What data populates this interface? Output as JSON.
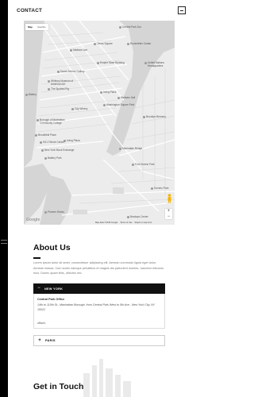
{
  "header": {
    "title": "CONTACT"
  },
  "map": {
    "type_buttons": [
      "Map",
      "Satellite"
    ],
    "labels": [
      "Central Park Zoo",
      "Times Square",
      "Rockefeller Center",
      "Madison Ave",
      "Empire State Building",
      "United Nations Headquarters",
      "David Zwirner Gallery",
      "Whitney Museum of American Art",
      "Irving Place",
      "Webster Hall",
      "Washington Square Park",
      "The Spotted Pig",
      "City Winery",
      "Borough of Manhattan Community College",
      "Brooklyn Brewery",
      "Brookfield Place",
      "9/11 Tribute Center",
      "New York Stock Exchange",
      "Battery Park",
      "Manhattan Bridge",
      "Fort Greene Park",
      "Pioneer Works",
      "Barclays Center",
      "Irving Plaza",
      "Domino Park",
      "Bakery"
    ],
    "zoom_in": "+",
    "zoom_out": "−",
    "logo": "Google",
    "attribution": [
      "Map data ©2019 Google",
      "Terms of Use",
      "Report a map error"
    ]
  },
  "about": {
    "title": "About Us",
    "text": "Lorem ipsum dolor sit amet, consectetuer adipiscing elit. Aenean commodo ligula eget dolor. Aenean massa. Cum sociis natoque penatibus et magnis dis parturient montes, nascetur ridiculus mus. Donec quam felis, ultricies nec."
  },
  "offices": {
    "ny": {
      "label": "NEW YORK",
      "icon": "minus",
      "title": "Central Park Office",
      "address": "14th to 110th St., Manhattan Borough, from Central Park West to 5th Ave., New York City, NY 10022",
      "phone": "office1"
    },
    "paris": {
      "label": "PARIS",
      "icon": "+"
    }
  },
  "touch": {
    "title": "Get in Touch"
  },
  "colors": {
    "accent": "#111111",
    "map_water": "#d0d0d0",
    "map_land": "#e9e9e9"
  }
}
